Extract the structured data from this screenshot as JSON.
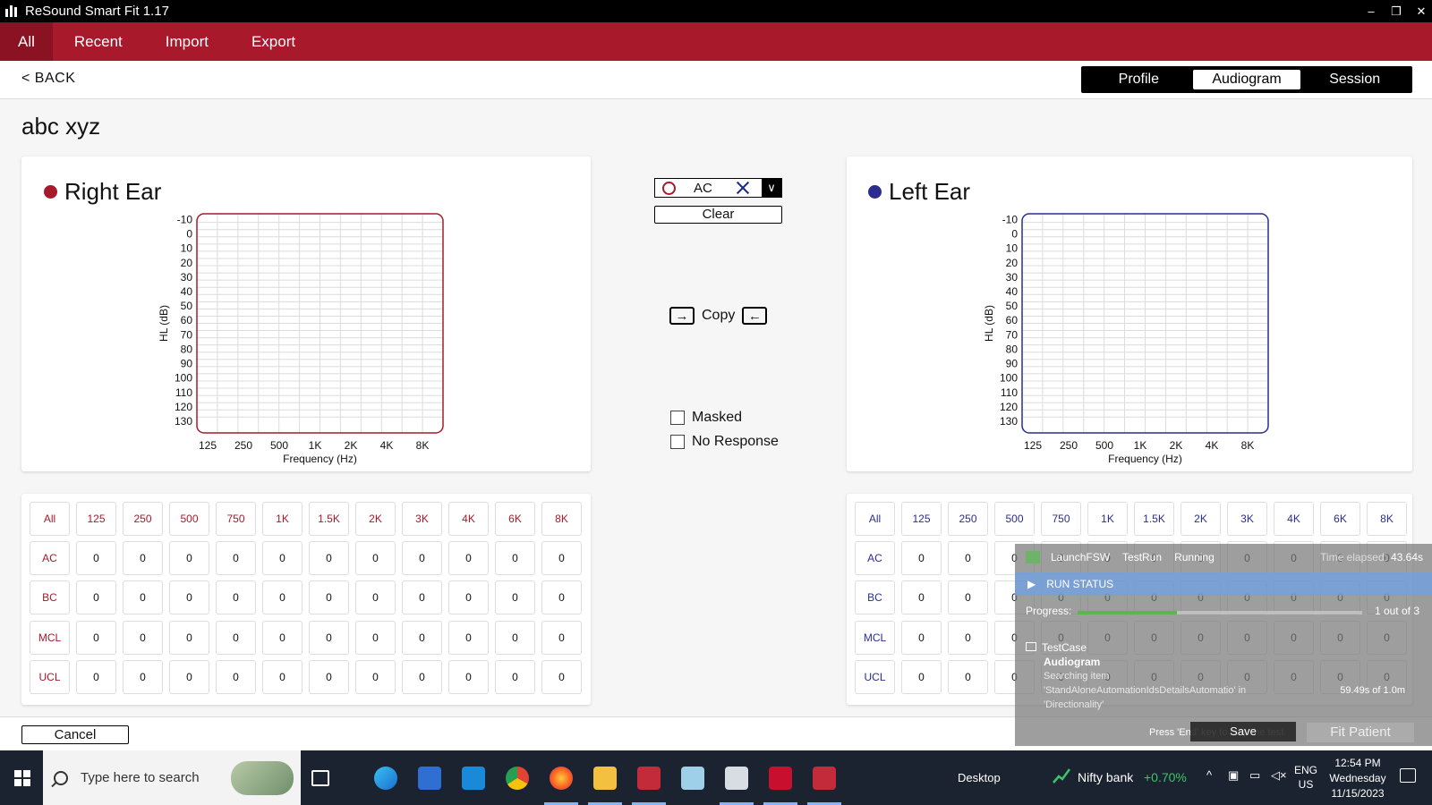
{
  "window": {
    "title": "ReSound Smart Fit 1.17",
    "controls": [
      "–",
      "❐",
      "✕"
    ]
  },
  "menu": {
    "items": [
      "All",
      "Recent",
      "Import",
      "Export"
    ],
    "active": "All"
  },
  "header": {
    "back_label": "< BACK",
    "tabs": [
      "Profile",
      "Audiogram",
      "Session"
    ],
    "active_tab": "Audiogram"
  },
  "patient": {
    "name": "abc xyz"
  },
  "right_ear": {
    "title": "Right Ear",
    "color": "#a7192b",
    "chart": {
      "ylabel": "HL (dB)",
      "xlabel": "Frequency (Hz)"
    }
  },
  "left_ear": {
    "title": "Left Ear",
    "color": "#2a2d8f",
    "chart": {
      "ylabel": "HL (dB)",
      "xlabel": "Frequency (Hz)"
    }
  },
  "chart_data": [
    {
      "type": "line",
      "title": "Right Ear",
      "xlabel": "Frequency (Hz)",
      "ylabel": "HL (dB)",
      "x_ticks": [
        "125",
        "250",
        "500",
        "1K",
        "2K",
        "4K",
        "8K"
      ],
      "y_ticks": [
        "-10",
        "0",
        "10",
        "20",
        "30",
        "40",
        "50",
        "60",
        "70",
        "80",
        "90",
        "100",
        "110",
        "120",
        "130"
      ],
      "ylim": [
        -10,
        130
      ],
      "y_inverted": true,
      "grid": true,
      "series": []
    },
    {
      "type": "line",
      "title": "Left Ear",
      "xlabel": "Frequency (Hz)",
      "ylabel": "HL (dB)",
      "x_ticks": [
        "125",
        "250",
        "500",
        "1K",
        "2K",
        "4K",
        "8K"
      ],
      "y_ticks": [
        "-10",
        "0",
        "10",
        "20",
        "30",
        "40",
        "50",
        "60",
        "70",
        "80",
        "90",
        "100",
        "110",
        "120",
        "130"
      ],
      "ylim": [
        -10,
        130
      ],
      "y_inverted": true,
      "grid": true,
      "series": []
    }
  ],
  "middle": {
    "type_select": "AC",
    "clear_label": "Clear",
    "copy_label": "Copy",
    "masked_label": "Masked",
    "no_response_label": "No Response"
  },
  "table": {
    "columns": [
      "All",
      "125",
      "250",
      "500",
      "750",
      "1K",
      "1.5K",
      "2K",
      "3K",
      "4K",
      "6K",
      "8K"
    ],
    "right_rows": [
      {
        "label": "AC",
        "values": [
          "0",
          "0",
          "0",
          "0",
          "0",
          "0",
          "0",
          "0",
          "0",
          "0",
          "0"
        ]
      },
      {
        "label": "BC",
        "values": [
          "0",
          "0",
          "0",
          "0",
          "0",
          "0",
          "0",
          "0",
          "0",
          "0",
          "0"
        ]
      },
      {
        "label": "MCL",
        "values": [
          "0",
          "0",
          "0",
          "0",
          "0",
          "0",
          "0",
          "0",
          "0",
          "0",
          "0"
        ]
      },
      {
        "label": "UCL",
        "values": [
          "0",
          "0",
          "0",
          "0",
          "0",
          "0",
          "0",
          "0",
          "0",
          "0",
          "0"
        ]
      }
    ],
    "left_rows": [
      {
        "label": "AC",
        "values": [
          "0",
          "0",
          "0",
          "0",
          "0",
          "0",
          "0",
          "0",
          "0",
          "0",
          "0"
        ]
      },
      {
        "label": "BC",
        "values": [
          "0",
          "0",
          "0",
          "0",
          "0",
          "0",
          "0",
          "0",
          "0",
          "0",
          "0"
        ]
      },
      {
        "label": "MCL",
        "values": [
          "0",
          "0",
          "0",
          "0",
          "0",
          "0",
          "0",
          "0",
          "0",
          "0",
          "0"
        ]
      },
      {
        "label": "UCL",
        "values": [
          "0",
          "0",
          "0",
          "0",
          "0",
          "0",
          "0",
          "0",
          "0",
          "0",
          "0"
        ]
      }
    ]
  },
  "bottom": {
    "cancel_label": "Cancel",
    "fit_patient_label": "Fit Patient"
  },
  "overlay": {
    "launch": "LaunchFSW",
    "testrun": "TestRun",
    "state": "Running",
    "elapsed_label": "Time elapsed:",
    "elapsed_value": "43.64s",
    "run_status": "RUN STATUS",
    "progress_label": "Progress:",
    "progress_fraction": 0.35,
    "progress_count": "1 out of 3",
    "testcase_label": "TestCase",
    "testcase_name": "Audiogram",
    "searching_line1": "Searching item",
    "searching_line2": "'StandAloneAutomationIdsDetailsAutomatio' in",
    "searching_line3": "'Directionality'",
    "elapsed_small": "59.49s of 1.0m",
    "press_text": "Press 'End' key to stop the test.",
    "save_label": "Save"
  },
  "taskbar": {
    "search_placeholder": "Type here to search",
    "desktop_label": "Desktop",
    "ticker_name": "Nifty bank",
    "ticker_change": "+0.70%",
    "lang_1": "ENG",
    "lang_2": "US",
    "time": "12:54 PM",
    "day": "Wednesday",
    "date": "11/15/2023"
  }
}
